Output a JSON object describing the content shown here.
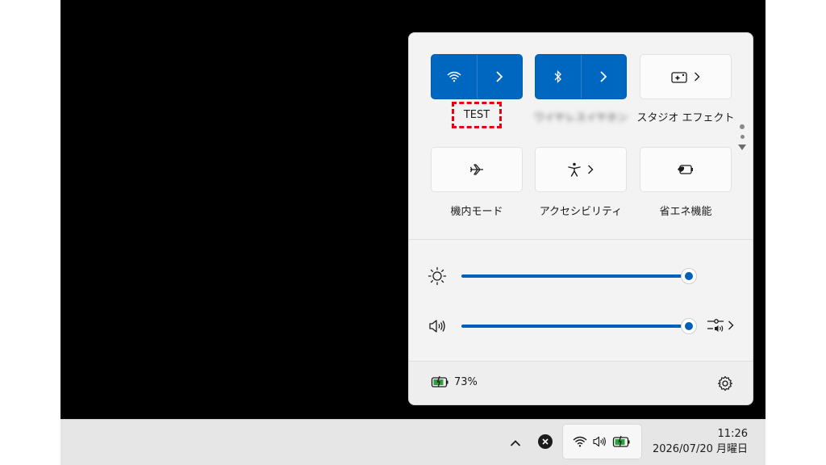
{
  "quick_settings": {
    "tiles": {
      "wifi": {
        "label": "TEST"
      },
      "bluetooth": {
        "label": "ワイヤレスイヤホン"
      },
      "studio_effects": {
        "label": "スタジオ エフェクト"
      },
      "airplane": {
        "label": "機内モード"
      },
      "accessibility": {
        "label": "アクセシビリティ"
      },
      "battery_saver": {
        "label": "省エネ機能"
      }
    },
    "brightness": {
      "level_percent": 100
    },
    "volume": {
      "level_percent": 100
    },
    "battery_percent": "73%"
  },
  "taskbar": {
    "time": "11:26",
    "date": "2026/07/20 月曜日"
  },
  "colors": {
    "accent": "#0067c0",
    "highlight": "#e60012",
    "battery_green": "#2ea043"
  }
}
